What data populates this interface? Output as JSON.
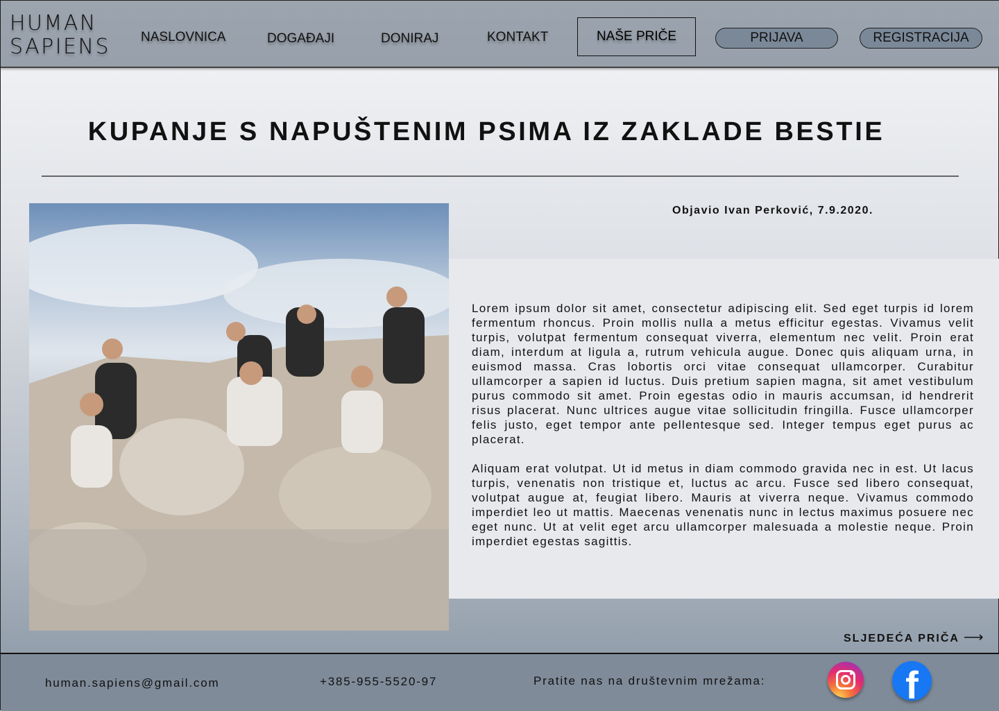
{
  "header": {
    "logo_line1": "HUMAN",
    "logo_line2": "SAPIENS",
    "nav": [
      "NASLOVNICA",
      "DOGAĐAJI",
      "DONIRAJ",
      "KONTAKT"
    ],
    "active_nav": "NAŠE PRIČE",
    "login": "PRIJAVA",
    "register": "REGISTRACIJA"
  },
  "article": {
    "title": "KUPANJE S NAPUŠTENIM PSIMA IZ ZAKLADE BESTIE",
    "byline": "Objavio Ivan Perković, 7.9.2020.",
    "paragraphs": [
      "Lorem ipsum dolor sit amet, consectetur adipiscing elit. Sed eget turpis id lorem fermentum rhoncus. Proin mollis nulla a metus efficitur egestas. Vivamus velit turpis, volutpat fermentum consequat viverra, elementum nec velit. Proin erat diam, interdum at ligula a, rutrum vehicula augue. Donec quis aliquam urna, in euismod massa. Cras lobortis orci vitae consequat ullamcorper. Curabitur ullamcorper a sapien id luctus. Duis pretium sapien magna, sit amet vestibulum purus commodo sit amet. Proin egestas odio in mauris accumsan, id hendrerit risus placerat. Nunc ultrices augue vitae sollicitudin fringilla. Fusce ullamcorper felis justo, eget tempor ante pellentesque sed. Integer tempus eget purus ac placerat.",
      "Aliquam erat volutpat. Ut id metus in diam commodo gravida nec in est. Ut lacus turpis, venenatis non tristique et, luctus ac arcu. Fusce sed libero consequat, volutpat augue at, feugiat libero. Mauris at viverra neque. Vivamus commodo imperdiet leo ut mattis. Maecenas venenatis nunc in lectus maximus posuere nec eget nunc. Ut at velit eget arcu ullamcorper malesuada a molestie neque. Proin imperdiet egestas sagittis."
    ],
    "next_story": "SLJEDEĆA PRIČA",
    "next_arrow": "⟶"
  },
  "footer": {
    "email": "human.sapiens@gmail.com",
    "phone": "+385-955-5520-97",
    "social_label": "Pratite nas na društevnim mrežama:",
    "facebook_glyph": "f"
  }
}
